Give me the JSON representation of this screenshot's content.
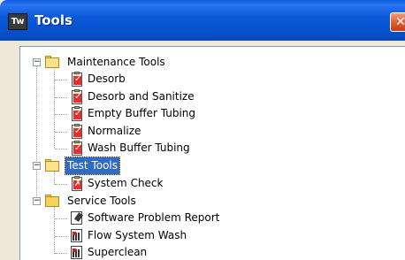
{
  "window": {
    "title": "Tools",
    "close_glyph": "✕",
    "app_icon_text": "Tw"
  },
  "tree": {
    "groups": [
      {
        "label": "Maintenance Tools",
        "expander": "−",
        "items": [
          "Desorb",
          "Desorb and Sanitize",
          "Empty Buffer Tubing",
          "Normalize",
          "Wash Buffer Tubing"
        ],
        "item_icon": "checklist-icon"
      },
      {
        "label": "Test Tools",
        "expander": "−",
        "selected": true,
        "items": [
          "System Check"
        ],
        "item_icon": "checklist-icon"
      },
      {
        "label": "Service Tools",
        "expander": "−",
        "items": [
          "Software Problem Report",
          "Flow System Wash",
          "Superclean"
        ],
        "item_icon": "service-icon"
      }
    ]
  }
}
